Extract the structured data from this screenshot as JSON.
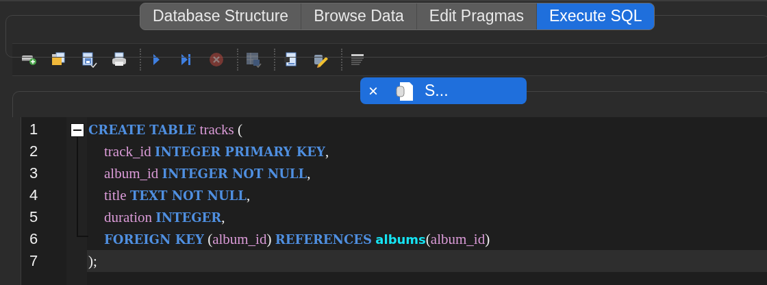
{
  "tabs": [
    {
      "label": "Database Structure",
      "selected": false
    },
    {
      "label": "Browse Data",
      "selected": false
    },
    {
      "label": "Edit Pragmas",
      "selected": false
    },
    {
      "label": "Execute SQL",
      "selected": true
    }
  ],
  "toolbar": [
    {
      "buttons": [
        {
          "disabled": false
        },
        {
          "disabled": false
        },
        {
          "disabled": false
        },
        {
          "disabled": false
        }
      ]
    },
    {
      "buttons": [
        {
          "disabled": false
        },
        {
          "disabled": false
        },
        {
          "disabled": true
        }
      ]
    },
    {
      "buttons": [
        {
          "disabled": true
        }
      ]
    },
    {
      "buttons": [
        {
          "disabled": false
        },
        {
          "disabled": false
        }
      ]
    },
    {
      "buttons": [
        {
          "disabled": false
        }
      ]
    }
  ],
  "sql_tabs": [
    {
      "close": "×",
      "label": "S...",
      "selected": true
    }
  ],
  "editor": {
    "lines": [
      {
        "number": "1",
        "current": false,
        "expanded": true,
        "tokens": [
          {
            "kind": "keyword",
            "text": "CREATE TABLE"
          },
          {
            "kind": "ident",
            "text": "tracks"
          },
          {
            "kind": "punct",
            "text": "("
          }
        ],
        "children": [
          {
            "number": "2",
            "current": false,
            "tokens": [
              {
                "kind": "ident",
                "text": "track_id"
              },
              {
                "kind": "keyword",
                "text": "INTEGER PRIMARY KEY"
              },
              {
                "kind": "punct",
                "text": ","
              }
            ]
          },
          {
            "number": "3",
            "current": false,
            "tokens": [
              {
                "kind": "ident",
                "text": "album_id"
              },
              {
                "kind": "keyword",
                "text": "INTEGER NOT NULL"
              },
              {
                "kind": "punct",
                "text": ","
              }
            ]
          },
          {
            "number": "4",
            "current": false,
            "tokens": [
              {
                "kind": "ident",
                "text": "title"
              },
              {
                "kind": "keyword",
                "text": "TEXT NOT NULL"
              },
              {
                "kind": "punct",
                "text": ","
              }
            ]
          },
          {
            "number": "5",
            "current": false,
            "tokens": [
              {
                "kind": "ident",
                "text": "duration"
              },
              {
                "kind": "keyword",
                "text": "INTEGER"
              },
              {
                "kind": "punct",
                "text": ","
              }
            ]
          },
          {
            "number": "6",
            "current": false,
            "tokens": [
              {
                "kind": "keyword",
                "text": "FOREIGN KEY"
              },
              {
                "kind": "punct",
                "text": "("
              },
              {
                "kind": "ident",
                "text": "album_id"
              },
              {
                "kind": "punct",
                "text": ")"
              },
              {
                "kind": "keyword",
                "text": "REFERENCES"
              },
              {
                "kind": "table",
                "text": "albums"
              },
              {
                "kind": "punct",
                "text": "("
              },
              {
                "kind": "ident",
                "text": "album_id"
              },
              {
                "kind": "punct",
                "text": ")"
              }
            ]
          }
        ]
      },
      {
        "number": "7",
        "current": true,
        "tokens": [
          {
            "kind": "punct",
            "text": ");"
          }
        ]
      }
    ]
  }
}
